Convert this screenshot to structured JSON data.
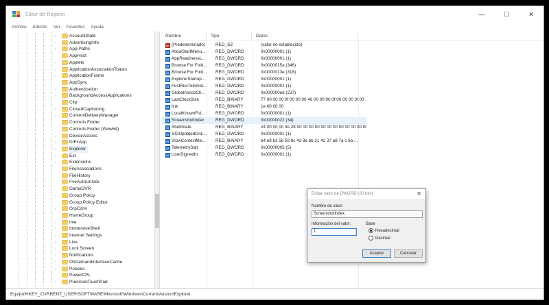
{
  "window": {
    "title": "Editor del Registro",
    "controls": {
      "minimize": "—",
      "maximize": "☐",
      "close": "✕"
    }
  },
  "menu": [
    "Archivo",
    "Edición",
    "Ver",
    "Favoritos",
    "Ayuda"
  ],
  "tree": {
    "items": [
      "AccountState",
      "AdvertisingInfo",
      "App Paths",
      "AppHost",
      "Applets",
      "ApplicationAssociationToasts",
      "ApplicationFrame",
      "AppSync",
      "Authentication",
      "BackgroundAccessApplications",
      "Clip",
      "ClosedCaptioning",
      "ContentDeliveryManager",
      "Controls Folder",
      "Controls Folder (Wow64)",
      "DeviceAccess",
      "DIFxApp",
      "Explorer",
      "Ext",
      "Extensions",
      "FileAssociations",
      "FileHistory",
      "FveAutoUnlock",
      "GameDVR",
      "Group Policy",
      "Group Policy Editor",
      "GrpConv",
      "HomeGroup",
      "ime",
      "ImmersiveShell",
      "Internet Settings",
      "Live",
      "Lock Screen",
      "Notifications",
      "OnDemandInterfaceCache",
      "Policies",
      "PowerCPL",
      "PrecisionTouchPad"
    ],
    "expandable": [
      true,
      true,
      true,
      false,
      true,
      true,
      true,
      false,
      true,
      true,
      false,
      true,
      true,
      false,
      false,
      true,
      true,
      true,
      true,
      true,
      false,
      false,
      false,
      false,
      true,
      false,
      true,
      false,
      true,
      true,
      true,
      true,
      true,
      true,
      true,
      true,
      false,
      true
    ],
    "selected_index": 17
  },
  "list": {
    "headers": {
      "name": "Nombre",
      "type": "Tipo",
      "data": "Datos"
    },
    "rows": [
      {
        "icon": "sz",
        "name": "(Predeterminado)",
        "type": "REG_SZ",
        "data": "(valor no establecido)"
      },
      {
        "icon": "bin",
        "name": "AllowStartMenu...",
        "type": "REG_DWORD",
        "data": "0x00000001 (1)"
      },
      {
        "icon": "bin",
        "name": "AppReadinessL...",
        "type": "REG_DWORD",
        "data": "0x00000001 (1)"
      },
      {
        "icon": "bin",
        "name": "Browse For Fold...",
        "type": "REG_DWORD",
        "data": "0x0000015a (346)"
      },
      {
        "icon": "bin",
        "name": "Browse For Fold...",
        "type": "REG_DWORD",
        "data": "0x0000013e (318)"
      },
      {
        "icon": "bin",
        "name": "ExplorerStartup...",
        "type": "REG_DWORD",
        "data": "0x00000001 (1)"
      },
      {
        "icon": "bin",
        "name": "FirstRunTelemet...",
        "type": "REG_DWORD",
        "data": "0x00000001 (1)"
      },
      {
        "icon": "bin",
        "name": "GlobalAssocCh...",
        "type": "REG_DWORD",
        "data": "0x000000ed (237)"
      },
      {
        "icon": "bin",
        "name": "LastClockSize",
        "type": "REG_BINARY",
        "data": "77 00 00 00 0f 00 00 00 46 00 00 00 0f 00 00 00 3f 00 ..."
      },
      {
        "icon": "bin",
        "name": "link",
        "type": "REG_BINARY",
        "data": "1e 00 00 00"
      },
      {
        "icon": "bin",
        "name": "LocalKnownFol...",
        "type": "REG_DWORD",
        "data": "0x00000001 (1)"
      },
      {
        "icon": "bin",
        "name": "ScreenshotIndex",
        "type": "REG_DWORD",
        "data": "0x00000022 (34)"
      },
      {
        "icon": "bin",
        "name": "ShellState",
        "type": "REG_BINARY",
        "data": "24 00 00 00 3e 28 00 00 00 00 00 00 00 00 00 00 00 00 00 ..."
      },
      {
        "icon": "bin",
        "name": "SIDUpdatedOnL...",
        "type": "REG_DWORD",
        "data": "0x00000001 (1)"
      },
      {
        "icon": "bin",
        "name": "SlowContextMe...",
        "type": "REG_BINARY",
        "data": "b4 e8 63 5b 59 8c 43 8a bb 21 42 37 a8 7a c 6a ..."
      },
      {
        "icon": "bin",
        "name": "TelemetrySalt",
        "type": "REG_DWORD",
        "data": "0x00000005 (5)"
      },
      {
        "icon": "bin",
        "name": "UserSignedIn",
        "type": "REG_DWORD",
        "data": "0x00000001 (1)"
      }
    ],
    "selected_index": 11
  },
  "status": {
    "path": "Equipo\\HKEY_CURRENT_USER\\SOFTWARE\\Microsoft\\Windows\\CurrentVersion\\Explorer"
  },
  "dialog": {
    "title": "Editar valor de DWORD (32 bits)",
    "close": "✕",
    "name_label": "Nombre de valor:",
    "name_value": "ScreenshotIndex",
    "data_label": "Información del valor:",
    "data_value": "1",
    "base_label": "Base",
    "radio_hex": "Hexadecimal",
    "radio_dec": "Decimal",
    "ok": "Aceptar",
    "cancel": "Cancelar"
  }
}
